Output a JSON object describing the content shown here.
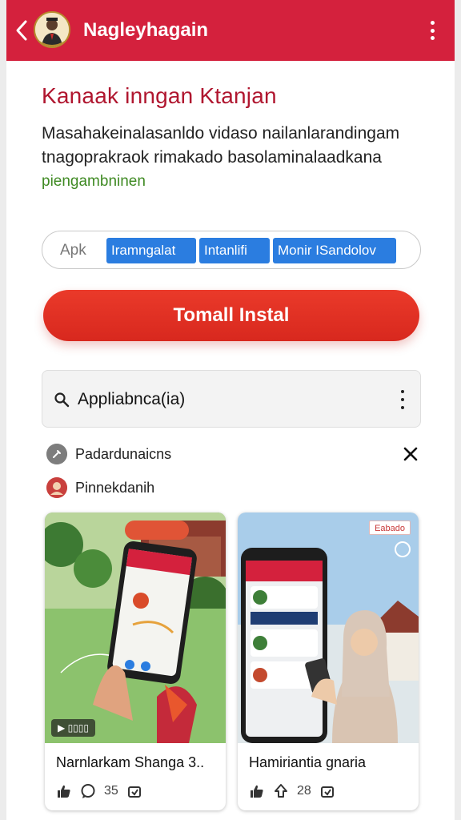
{
  "header": {
    "title": "Naglеyhagain",
    "bg_color": "#d4213d"
  },
  "section": {
    "heading": "Kanaak inngan Ktanjan",
    "description_line1": "Masahakeinalasanldo vidaso nailanlarandingam",
    "description_line2": "tnagoprakraok rimakado basolaminalaadkana",
    "description_line3": "piengambninen"
  },
  "tags": {
    "plain": "Apk",
    "chips": [
      "Iramngalat",
      "Intanlifi",
      "Monir ISandolov"
    ]
  },
  "install_button": {
    "label": "Tomall Instal",
    "color": "#e33426"
  },
  "search": {
    "value": "Appliabnca(ia)"
  },
  "list": [
    {
      "label": "Padardunaicns",
      "icon": "settings-icon"
    },
    {
      "label": "Pinnekdanih",
      "icon": "profile-icon"
    }
  ],
  "cards": [
    {
      "title": "Narnlarkam Shanga 3..",
      "likes_icon": "thumbs-up-icon",
      "comments": "35",
      "video_label": "▶ ▯▯▯▯",
      "theme": "garden-map-phone"
    },
    {
      "title": "Hamiriantia gnaria",
      "likes_icon": "thumbs-up-icon",
      "comments": "28",
      "tag": "Eabado",
      "theme": "person-with-phone"
    }
  ]
}
